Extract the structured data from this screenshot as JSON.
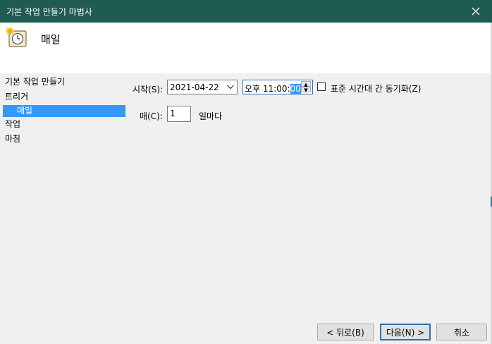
{
  "window": {
    "title": "기본 작업 만들기 마법사"
  },
  "header": {
    "title": "매일",
    "icon": "scheduled-task-clock-icon"
  },
  "sidebar": {
    "items": [
      {
        "label": "기본 작업 만들기"
      },
      {
        "label": "트리거"
      },
      {
        "label": "매일"
      },
      {
        "label": "작업"
      },
      {
        "label": "마침"
      }
    ]
  },
  "form": {
    "start_label": "시작(S):",
    "start_date": "2021-04-22",
    "start_time_prefix": "오후 11:00:",
    "start_time_selected": "00",
    "sync_timezones_label": "표준 시간대 간 동기화(Z)",
    "every_label": "매(C):",
    "every_value": "1",
    "every_suffix": "일마다"
  },
  "buttons": {
    "back": "< 뒤로(B)",
    "next": "다음(N) >",
    "cancel": "취소"
  },
  "colors": {
    "titlebar": "#1f5b50",
    "selection": "#3399ff",
    "focus_border": "#2f6fb0"
  }
}
